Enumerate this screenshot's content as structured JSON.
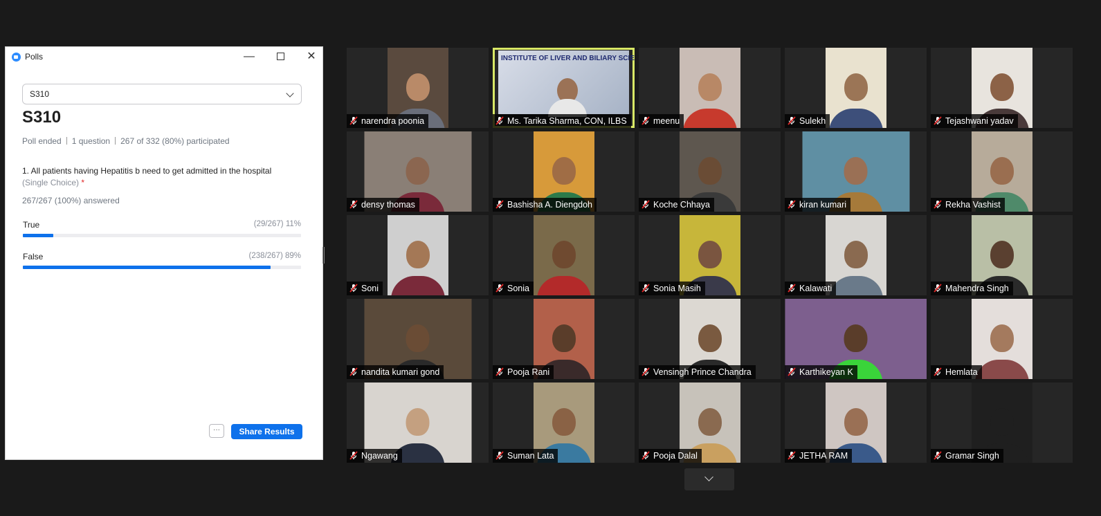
{
  "window": {
    "title": "Polls",
    "app_icon": "zoom-icon"
  },
  "poll": {
    "selected": "S310",
    "title": "S310",
    "status": "Poll ended",
    "questions": "1 question",
    "participation": "267 of 332 (80%) participated",
    "question_text": "1. All patients having Hepatitis b need to get admitted in the hospital",
    "question_type": "(Single Choice)",
    "required_mark": "*",
    "answered": "267/267 (100%) answered",
    "options": [
      {
        "label": "True",
        "count": "(29/267) 11%",
        "fraction": 0.11
      },
      {
        "label": "False",
        "count": "(238/267) 89%",
        "fraction": 0.89
      }
    ],
    "more_label": "···",
    "share_label": "Share Results",
    "accent": "#0e71eb"
  },
  "gallery": {
    "active_speaker_border": "#d9e866",
    "speaker_slide_title": "INSTITUTE OF LIVER AND BILIARY SCIENCES",
    "participants": [
      {
        "name": "narendra poonia",
        "bg": "#5a4a3e",
        "skin": "#b98a68",
        "shirt": "#6a6e7a"
      },
      {
        "name": "Ms. Tarika Sharma, CON, ILBS",
        "speaking": true
      },
      {
        "name": "meenu",
        "bg": "#c9bcb5",
        "skin": "#b88866",
        "shirt": "#c73a2d"
      },
      {
        "name": "Sulekh",
        "bg": "#e9e2cf",
        "skin": "#9b7556",
        "shirt": "#3d4f7a"
      },
      {
        "name": "Tejashwani yadav",
        "bg": "#e8e4de",
        "skin": "#8c6247",
        "shirt": "#4a3a3a"
      },
      {
        "name": "densy thomas",
        "bg": "#8a7f76",
        "skin": "#8b6650",
        "shirt": "#7a2a3a"
      },
      {
        "name": "Bashisha A. Diengdoh",
        "bg": "#d79a3a",
        "skin": "#a06d45",
        "shirt": "#2d7a4a"
      },
      {
        "name": "Koche Chhaya",
        "bg": "#5e574f",
        "skin": "#6a4c35",
        "shirt": "#3a3a3a"
      },
      {
        "name": "kiran kumari",
        "bg": "#5f8fa3",
        "skin": "#9a7055",
        "shirt": "#a67a3a"
      },
      {
        "name": "Rekha Vashist",
        "bg": "#b7ab9a",
        "skin": "#9a6e50",
        "shirt": "#4f8a6a"
      },
      {
        "name": "Soni",
        "bg": "#cfcfcf",
        "skin": "#a47856",
        "shirt": "#7a2a3a"
      },
      {
        "name": "Sonia",
        "bg": "#7a6a4a",
        "skin": "#6f4a30",
        "shirt": "#b32a2a"
      },
      {
        "name": "Sonia Masih",
        "bg": "#c7b63a",
        "skin": "#7a5540",
        "shirt": "#3a3a4a"
      },
      {
        "name": "Kalawati",
        "bg": "#d8d6d2",
        "skin": "#8a6a50",
        "shirt": "#6a7a8a"
      },
      {
        "name": "Mahendra Singh",
        "bg": "#b9bfa6",
        "skin": "#5a4030",
        "shirt": "#2a2a2a"
      },
      {
        "name": "nandita kumari gond",
        "bg": "#5a4a3a",
        "skin": "#6a4c35",
        "shirt": "#2a2a2a"
      },
      {
        "name": "Pooja Rani",
        "bg": "#b2604a",
        "skin": "#5a3d2a",
        "shirt": "#3a2a2a"
      },
      {
        "name": "Vensingh Prince Chandra",
        "bg": "#dcd8d2",
        "skin": "#7a5a40",
        "shirt": "#2a2a2a"
      },
      {
        "name": "Karthikeyan K",
        "bg": "#7d5f8e",
        "skin": "#5a3d2a",
        "shirt": "#3ad43a"
      },
      {
        "name": "Hemlata",
        "bg": "#e4dedb",
        "skin": "#a47a5e",
        "shirt": "#8a4a4a"
      },
      {
        "name": "Ngawang",
        "bg": "#d8d4cf",
        "skin": "#c4a080",
        "shirt": "#2a3142"
      },
      {
        "name": "Suman Lata",
        "bg": "#a89a7c",
        "skin": "#8a6245",
        "shirt": "#3a7aa0"
      },
      {
        "name": "Pooja Dalal",
        "bg": "#c7c2ba",
        "skin": "#8a6a50",
        "shirt": "#c9a060"
      },
      {
        "name": "JETHA RAM",
        "bg": "#cfc6c2",
        "skin": "#9a7055",
        "shirt": "#3a5a8a"
      },
      {
        "name": "Gramar Singh",
        "bg": "#1f1f1f",
        "skin": "#1f1f1f",
        "shirt": "#1f1f1f"
      }
    ]
  }
}
